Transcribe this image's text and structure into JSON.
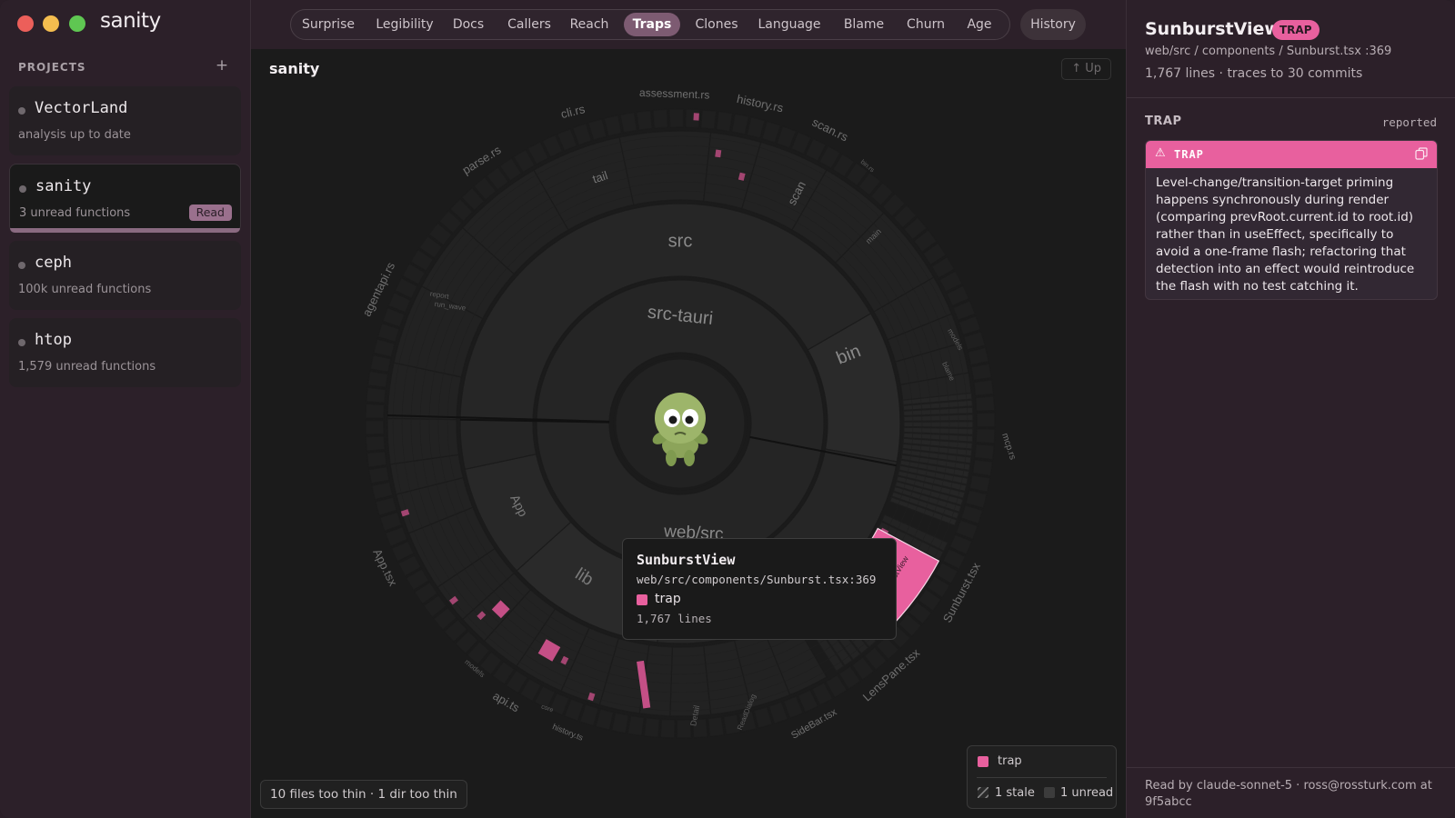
{
  "app": {
    "name": "sanity",
    "window_controls": [
      "close",
      "minimize",
      "maximize"
    ]
  },
  "sidebar": {
    "heading": "PROJECTS",
    "add_label": "+",
    "projects": [
      {
        "name": "VectorLand",
        "status": "analysis up to date",
        "active": false
      },
      {
        "name": "sanity",
        "status": "3 unread functions",
        "action": "Read",
        "active": true
      },
      {
        "name": "ceph",
        "status": "100k unread functions",
        "active": false
      },
      {
        "name": "htop",
        "status": "1,579 unread functions",
        "active": false
      }
    ]
  },
  "nav": {
    "tabs": [
      "Surprise",
      "Legibility",
      "Docs",
      "Callers",
      "Reach",
      "Traps",
      "Clones",
      "Language",
      "Blame",
      "Churn",
      "Age"
    ],
    "active_tab": "Traps",
    "history_label": "History"
  },
  "main": {
    "title": "sanity",
    "up_label": "↑ Up",
    "thin_note": "10 files too thin · 1 dir too thin",
    "legend": {
      "trap_label": "trap",
      "trap_color": "#e8609e",
      "stale_label": "1 stale",
      "unread_label": "1 unread"
    },
    "sunburst": {
      "mascot": "turtle-mascot",
      "ring1": [
        "src-tauri",
        "web/src"
      ],
      "ring2": [
        "src",
        "bin",
        "App",
        "lib"
      ],
      "ring3": [
        "tail",
        "scan",
        "main"
      ],
      "outer_labels": [
        "parse.rs",
        "cli.rs",
        "assessment.rs",
        "history.rs",
        "scan.rs",
        "agentapi.rs",
        "App.tsx",
        "Sunburst.tsx",
        "LensPane.tsx",
        "SideBar.tsx",
        "api.ts",
        "history.ts",
        "mcp.rs"
      ],
      "small_labels": [
        "report",
        "run_wave",
        "ReadDialog",
        "Detail",
        "models",
        "core",
        "bin.rs",
        "models",
        "blame"
      ],
      "highlight": "SunburstView"
    },
    "tooltip": {
      "title": "SunburstView",
      "path": "web/src/components/Sunburst.tsx:369",
      "category": "trap",
      "lines": "1,767 lines"
    }
  },
  "panel": {
    "title": "SunburstView",
    "badge": "TRAP",
    "path": "web/src / components / Sunburst.tsx :369",
    "meta": "1,767 lines · traces to 30 commits",
    "section_heading": "TRAP",
    "section_status": "reported",
    "card_label": "TRAP",
    "card_body": "Level-change/transition-target priming happens synchronously during render (comparing prevRoot.current.id to root.id) rather than in useEffect, specifically to avoid a one-frame flash; refactoring that detection into an effect would reintroduce the flash with no test catching it.",
    "footer": "Read by claude-sonnet-5 · ross@rossturk.com at 9f5abcc"
  },
  "colors": {
    "accent": "#e8609e",
    "active_tab": "#7d5b72",
    "sidebar_bg": "#2c2029"
  }
}
